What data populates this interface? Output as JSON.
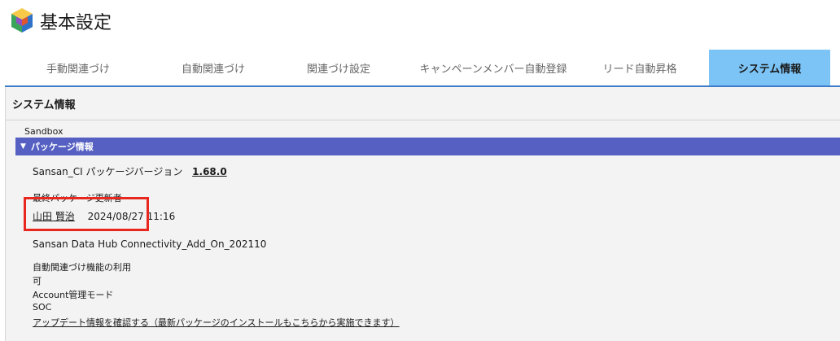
{
  "header": {
    "title": "基本設定",
    "logo_icon": "cube-icon"
  },
  "tabs": [
    {
      "label": "手動関連づけ",
      "active": false
    },
    {
      "label": "自動関連づけ",
      "active": false
    },
    {
      "label": "関連づけ設定",
      "active": false
    },
    {
      "label": "キャンペーンメンバー自動登録",
      "active": false
    },
    {
      "label": "リード自動昇格",
      "active": false
    },
    {
      "label": "システム情報",
      "active": true
    }
  ],
  "panel": {
    "title": "システム情報",
    "environment": "Sandbox",
    "section": {
      "label": "パッケージ情報",
      "toggle_icon": "triangle-down-icon"
    },
    "package_version_label": "Sansan_CI パッケージバージョン",
    "package_version_value": "1.68.0",
    "last_updater_label": "最終パッケージ更新者",
    "last_updater_name": "山田 賢治",
    "last_updated_at": "2024/08/27 11:16",
    "addon_name": "Sansan Data Hub Connectivity_Add_On_202110",
    "auto_link_label": "自動関連づけ機能の利用",
    "auto_link_value": "可",
    "account_mode_label": "Account管理モード",
    "account_mode_value": "SOC",
    "update_link": "アップデート情報を確認する（最新パッケージのインストールもこちらから実施できます）"
  },
  "colors": {
    "active_tab": "#7cc4f6",
    "section_bar": "#5560c2",
    "highlight": "#e8281e",
    "tab_underline": "#3d7cc9"
  }
}
